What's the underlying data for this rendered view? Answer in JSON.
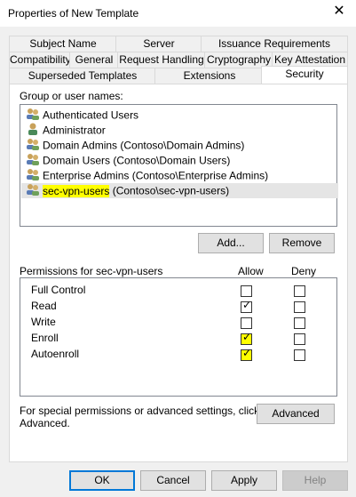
{
  "window": {
    "title": "Properties of New Template",
    "close_glyph": "✕"
  },
  "tabs": {
    "row1": [
      "Subject Name",
      "Server",
      "Issuance Requirements"
    ],
    "row2": [
      "Compatibility",
      "General",
      "Request Handling",
      "Cryptography",
      "Key Attestation"
    ],
    "row3": [
      "Superseded Templates",
      "Extensions",
      "Security"
    ],
    "active": "Security"
  },
  "security": {
    "group_label": "Group or user names:",
    "users": [
      {
        "name": "Authenticated Users",
        "icon": "users-icon"
      },
      {
        "name": "Administrator",
        "icon": "user-icon"
      },
      {
        "name": "Domain Admins (Contoso\\Domain Admins)",
        "icon": "users-icon"
      },
      {
        "name": "Domain Users (Contoso\\Domain Users)",
        "icon": "users-icon"
      },
      {
        "name": "Enterprise Admins (Contoso\\Enterprise Admins)",
        "icon": "users-icon"
      },
      {
        "name_highlight": "sec-vpn-users",
        "name_rest": " (Contoso\\sec-vpn-users)",
        "icon": "users-icon",
        "selected": true
      }
    ],
    "add_label": "Add...",
    "remove_label": "Remove",
    "perm_label": "Permissions for sec-vpn-users",
    "allow_label": "Allow",
    "deny_label": "Deny",
    "permissions": [
      {
        "name": "Full Control",
        "allow": false,
        "deny": false
      },
      {
        "name": "Read",
        "allow": true,
        "deny": false
      },
      {
        "name": "Write",
        "allow": false,
        "deny": false
      },
      {
        "name": "Enroll",
        "allow": true,
        "deny": false,
        "highlight": true
      },
      {
        "name": "Autoenroll",
        "allow": true,
        "deny": false,
        "highlight": true
      }
    ],
    "special_text_1": "For special permissions or advanced settings, click",
    "special_text_2": "Advanced.",
    "advanced_label": "Advanced"
  },
  "footer": {
    "ok": "OK",
    "cancel": "Cancel",
    "apply": "Apply",
    "help": "Help"
  },
  "colors": {
    "highlight": "#ffff00",
    "accent": "#0078d7"
  }
}
